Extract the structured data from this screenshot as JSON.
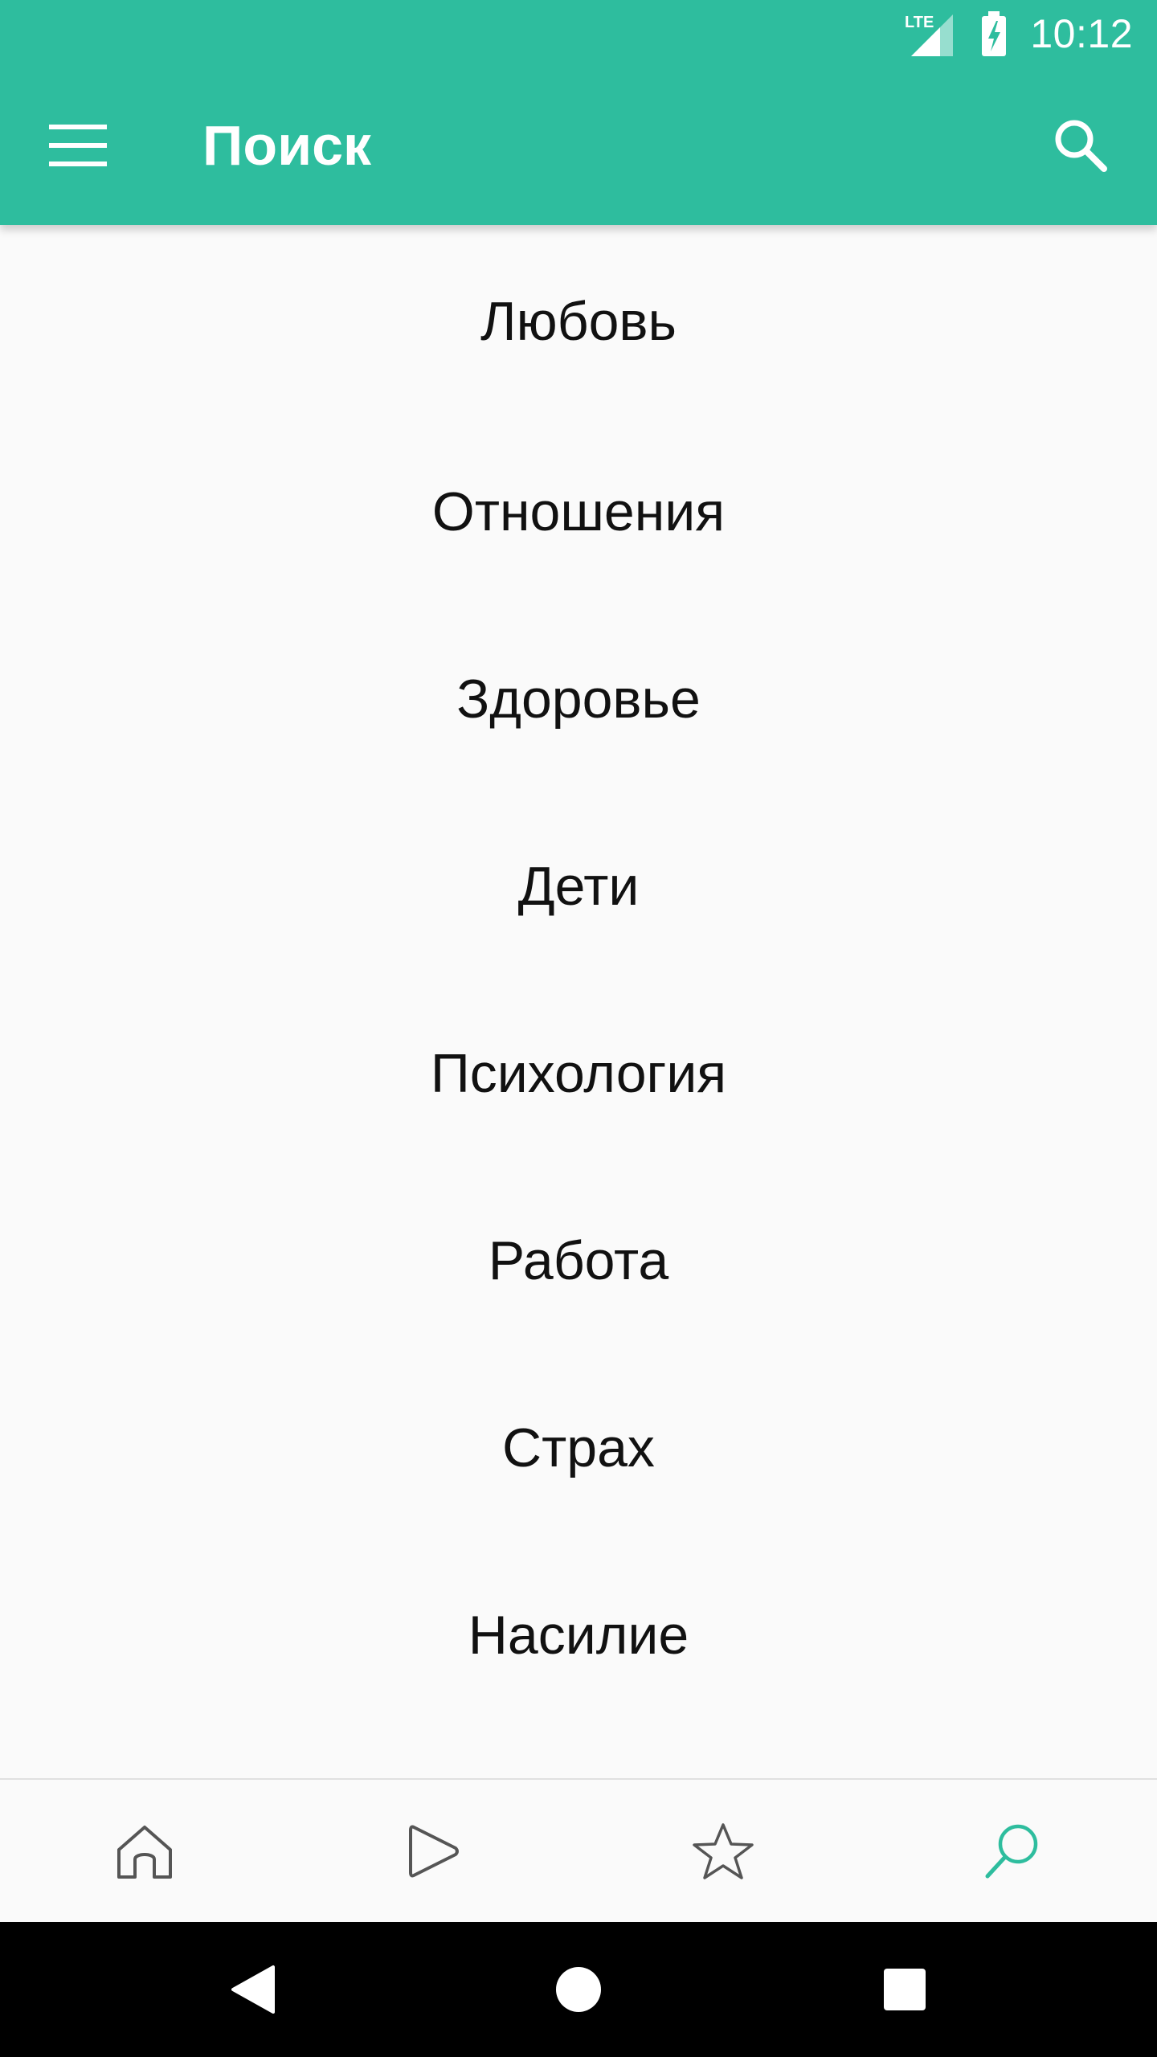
{
  "status_bar": {
    "network_label": "LTE",
    "time": "10:12"
  },
  "toolbar": {
    "title": "Поиск",
    "menu_icon": "hamburger-menu-icon",
    "search_icon": "search-icon"
  },
  "topics": [
    {
      "label": "Любовь"
    },
    {
      "label": "Отношения"
    },
    {
      "label": "Здоровье"
    },
    {
      "label": "Дети"
    },
    {
      "label": "Психология"
    },
    {
      "label": "Работа"
    },
    {
      "label": "Страх"
    },
    {
      "label": "Насилие"
    }
  ],
  "bottom_nav": {
    "items": [
      {
        "icon": "home-icon",
        "active": false
      },
      {
        "icon": "play-icon",
        "active": false
      },
      {
        "icon": "star-icon",
        "active": false
      },
      {
        "icon": "search-icon",
        "active": true
      }
    ]
  },
  "system_nav": {
    "back": "back-triangle-icon",
    "home": "home-circle-icon",
    "recents": "recents-square-icon"
  },
  "colors": {
    "primary": "#2EBD9E",
    "background": "#FAFAFA",
    "text": "#111111",
    "icon_inactive": "#555555",
    "icon_active": "#2EBD9E"
  }
}
